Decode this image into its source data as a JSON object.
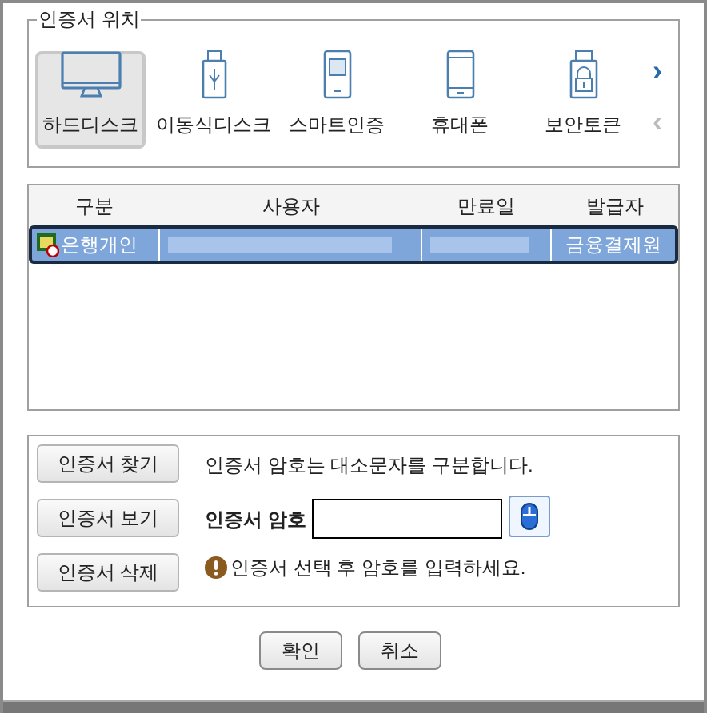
{
  "location": {
    "legend": "인증서 위치",
    "items": [
      {
        "label": "하드디스크",
        "kind": "monitor",
        "selected": true
      },
      {
        "label": "이동식디스크",
        "kind": "usb",
        "selected": false
      },
      {
        "label": "스마트인증",
        "kind": "chip",
        "selected": false
      },
      {
        "label": "휴대폰",
        "kind": "phone",
        "selected": false
      },
      {
        "label": "보안토큰",
        "kind": "lock",
        "selected": false
      }
    ],
    "next": "›",
    "prev": "‹"
  },
  "table": {
    "columns": [
      "구분",
      "사용자",
      "만료일",
      "발급자"
    ],
    "rows": [
      {
        "type": "은행개인",
        "issuer": "금융결제원",
        "selected": true
      }
    ]
  },
  "actions": {
    "buttons": [
      "인증서 찾기",
      "인증서 보기",
      "인증서 삭제"
    ],
    "notice": "인증서 암호는 대소문자를 구분합니다.",
    "password": {
      "label": "인증서 암호"
    },
    "warning": "인증서 선택 후 암호를 입력하세요."
  },
  "footer": {
    "buttons": [
      "확인",
      "취소"
    ]
  }
}
